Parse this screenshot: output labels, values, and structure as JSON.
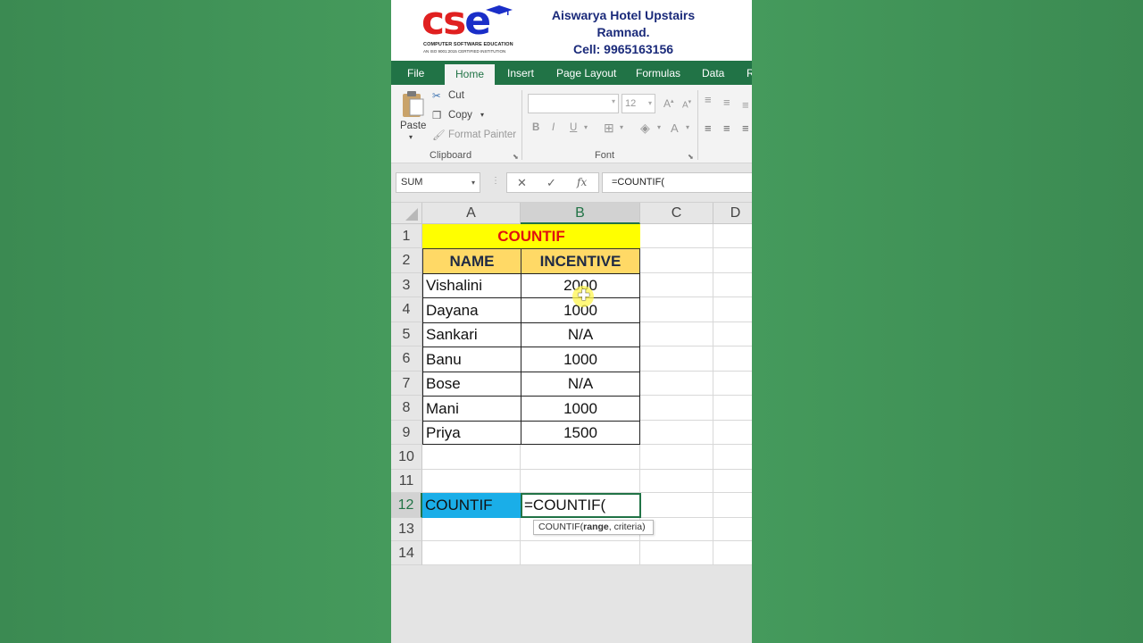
{
  "banner": {
    "logo_c": "c",
    "logo_s": "s",
    "logo_e": "e",
    "logo_sub": "COMPUTER SOFTWARE EDUCATION",
    "logo_sub2": "AN ISO 9001:2015 CERTIFIED INSTITUTION",
    "address_line1": "Aiswarya Hotel Upstairs",
    "address_line2": "Ramnad.",
    "phone": "Cell: 9965163156"
  },
  "tabs": [
    "File",
    "Home",
    "Insert",
    "Page Layout",
    "Formulas",
    "Data",
    "R"
  ],
  "active_tab": "Home",
  "ribbon": {
    "paste": "Paste",
    "cut": "Cut",
    "copy": "Copy",
    "format_painter": "Format Painter",
    "clipboard_label": "Clipboard",
    "font_label": "Font",
    "font_name": "",
    "font_size": "12",
    "bold": "B",
    "italic": "I",
    "underline": "U"
  },
  "formula_bar": {
    "name_box": "SUM",
    "cancel": "✕",
    "enter": "✓",
    "fx": "fx",
    "formula": "=COUNTIF("
  },
  "columns": [
    "A",
    "B",
    "C",
    "D"
  ],
  "rows": [
    "1",
    "2",
    "3",
    "4",
    "5",
    "6",
    "7",
    "8",
    "9",
    "10",
    "11",
    "12",
    "13",
    "14"
  ],
  "sheet": {
    "title": "COUNTIF",
    "header_name": "NAME",
    "header_incentive": "INCENTIVE",
    "data": [
      {
        "name": "Vishalini",
        "incentive": "2000"
      },
      {
        "name": "Dayana",
        "incentive": "1000"
      },
      {
        "name": "Sankari",
        "incentive": "N/A"
      },
      {
        "name": "Banu",
        "incentive": "1000"
      },
      {
        "name": "Bose",
        "incentive": "N/A"
      },
      {
        "name": "Mani",
        "incentive": "1000"
      },
      {
        "name": "Priya",
        "incentive": "1500"
      }
    ],
    "countif_label": "COUNTIF",
    "active_cell_value": "=COUNTIF("
  },
  "tooltip": {
    "fn": "COUNTIF(",
    "arg1": "range",
    "rest": ", criteria)"
  },
  "colors": {
    "excel_green": "#217346",
    "title_yellow": "#ffff00",
    "header_gold": "#ffd966",
    "countif_cyan": "#1aaee8",
    "title_red": "#e01010"
  }
}
